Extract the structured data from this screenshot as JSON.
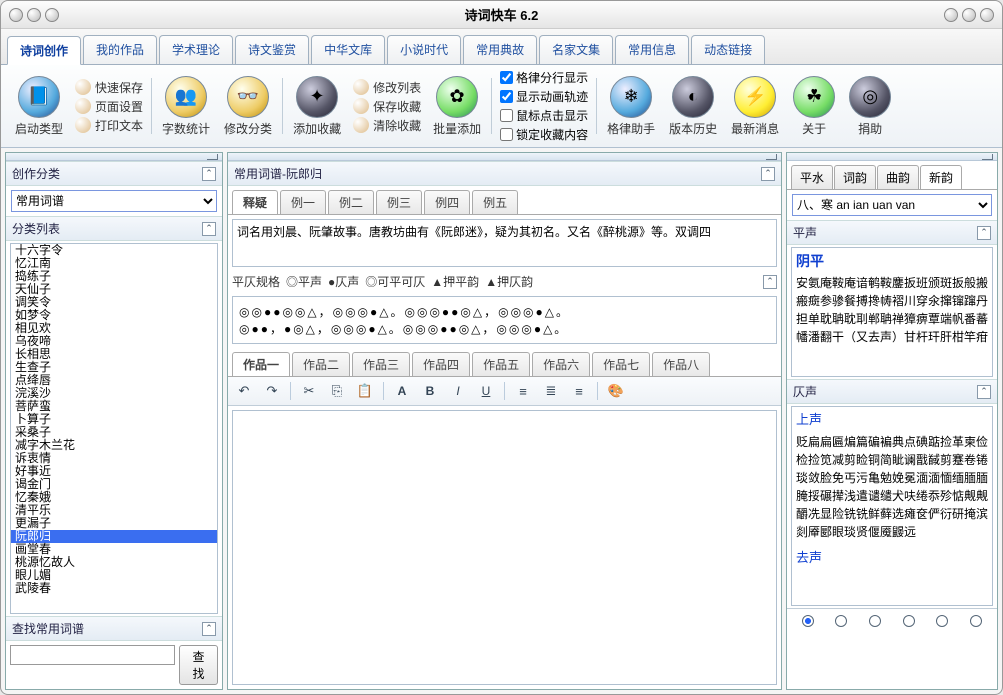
{
  "title": "诗词快车 6.2",
  "main_tabs": [
    "诗词创作",
    "我的作品",
    "学术理论",
    "诗文鉴赏",
    "中华文库",
    "小说时代",
    "常用典故",
    "名家文集",
    "常用信息",
    "动态链接"
  ],
  "main_tab_active": 0,
  "toolbar": {
    "start_type": "启动类型",
    "quick_save": "快速保存",
    "page_setup": "页面设置",
    "print_text": "打印文本",
    "word_count": "字数统计",
    "modify_cat": "修改分类",
    "add_fav": "添加收藏",
    "modify_list": "修改列表",
    "save_fav": "保存收藏",
    "clear_fav": "清除收藏",
    "batch_add": "批量添加",
    "opt1": "格律分行显示",
    "opt2": "显示动画轨迹",
    "opt3": "鼠标点击显示",
    "opt4": "锁定收藏内容",
    "gelv": "格律助手",
    "history": "版本历史",
    "news": "最新消息",
    "about": "关于",
    "donate": "捐助"
  },
  "left": {
    "cat_title": "创作分类",
    "cat_select": "常用词谱",
    "list_title": "分类列表",
    "items": [
      "十六字令",
      "忆江南",
      "捣练子",
      "天仙子",
      "调笑令",
      "如梦令",
      "相见欢",
      "乌夜啼",
      "长相思",
      "生查子",
      "点绛唇",
      "浣溪沙",
      "菩萨蛮",
      "卜算子",
      "采桑子",
      "减字木兰花",
      "诉衷情",
      "好事近",
      "谒金门",
      "忆秦娥",
      "清平乐",
      "更漏子",
      "阮郎归",
      "画堂春",
      "桃源忆故人",
      "眼儿媚",
      "武陵春"
    ],
    "selected_index": 22,
    "search_title": "查找常用词谱",
    "search_btn": "查找"
  },
  "center": {
    "header": "常用词谱-阮郎归",
    "ex_tabs": [
      "释疑",
      "例一",
      "例二",
      "例三",
      "例四",
      "例五"
    ],
    "ex_active": 0,
    "ex_text": "词名用刘晨、阮肇故事。唐教坊曲有《阮郎迷》，疑为其初名。又名《醉桃源》等。双调四",
    "rule_label": "平仄规格",
    "legend": {
      "ping": "◎平声",
      "ze": "●仄声",
      "either": "◎可平可仄",
      "pingyun": "▲押平韵",
      "zeyun": "▲押仄韵"
    },
    "pattern_line1": "◎◎●●◎◎△，◎◎◎●△。◎◎◎●●◎△，◎◎◎●△。",
    "pattern_line2": "◎●●，●◎△，◎◎◎●△。◎◎◎●●◎△，◎◎◎●△。",
    "work_tabs": [
      "作品一",
      "作品二",
      "作品三",
      "作品四",
      "作品五",
      "作品六",
      "作品七",
      "作品八"
    ],
    "work_active": 0
  },
  "right": {
    "tabs": [
      "平水",
      "词韵",
      "曲韵",
      "新韵"
    ],
    "tab_active": 3,
    "select": "八、寒 an ian uan van",
    "ping_title": "平声",
    "yinping": "阴平",
    "yinping_text": "安氨庵鞍庵谙鹌鞍鏖扳班颁斑扳般搬瘢癍参骖餐搏搀帱褶川穿氽撺镩蹿丹担单耽聃耽刵郸聃禅獐痹覃端帆番蕃幡潘翻干（又去声）甘杆玕肝柑竿疳",
    "ze_title": "仄声",
    "shangsheng": "上声",
    "shang_text": "贬扁扁匾煸篇碥褊典点碘踮捡革柬俭检捡笕减剪睑铜简眦谰戬馘剪蹇卷锩琰敛脸免丐污亀勉娩冕湎湎愐缅腼腼腌挼碾撵浅遣谴缱犬呋绻忝殄惦觍觍釂冼显险铣铣鲜藓选瘫奁俨衍研掩滨剡厣郾眼琰贤偃魇鼹远",
    "qusheng": "去声"
  }
}
